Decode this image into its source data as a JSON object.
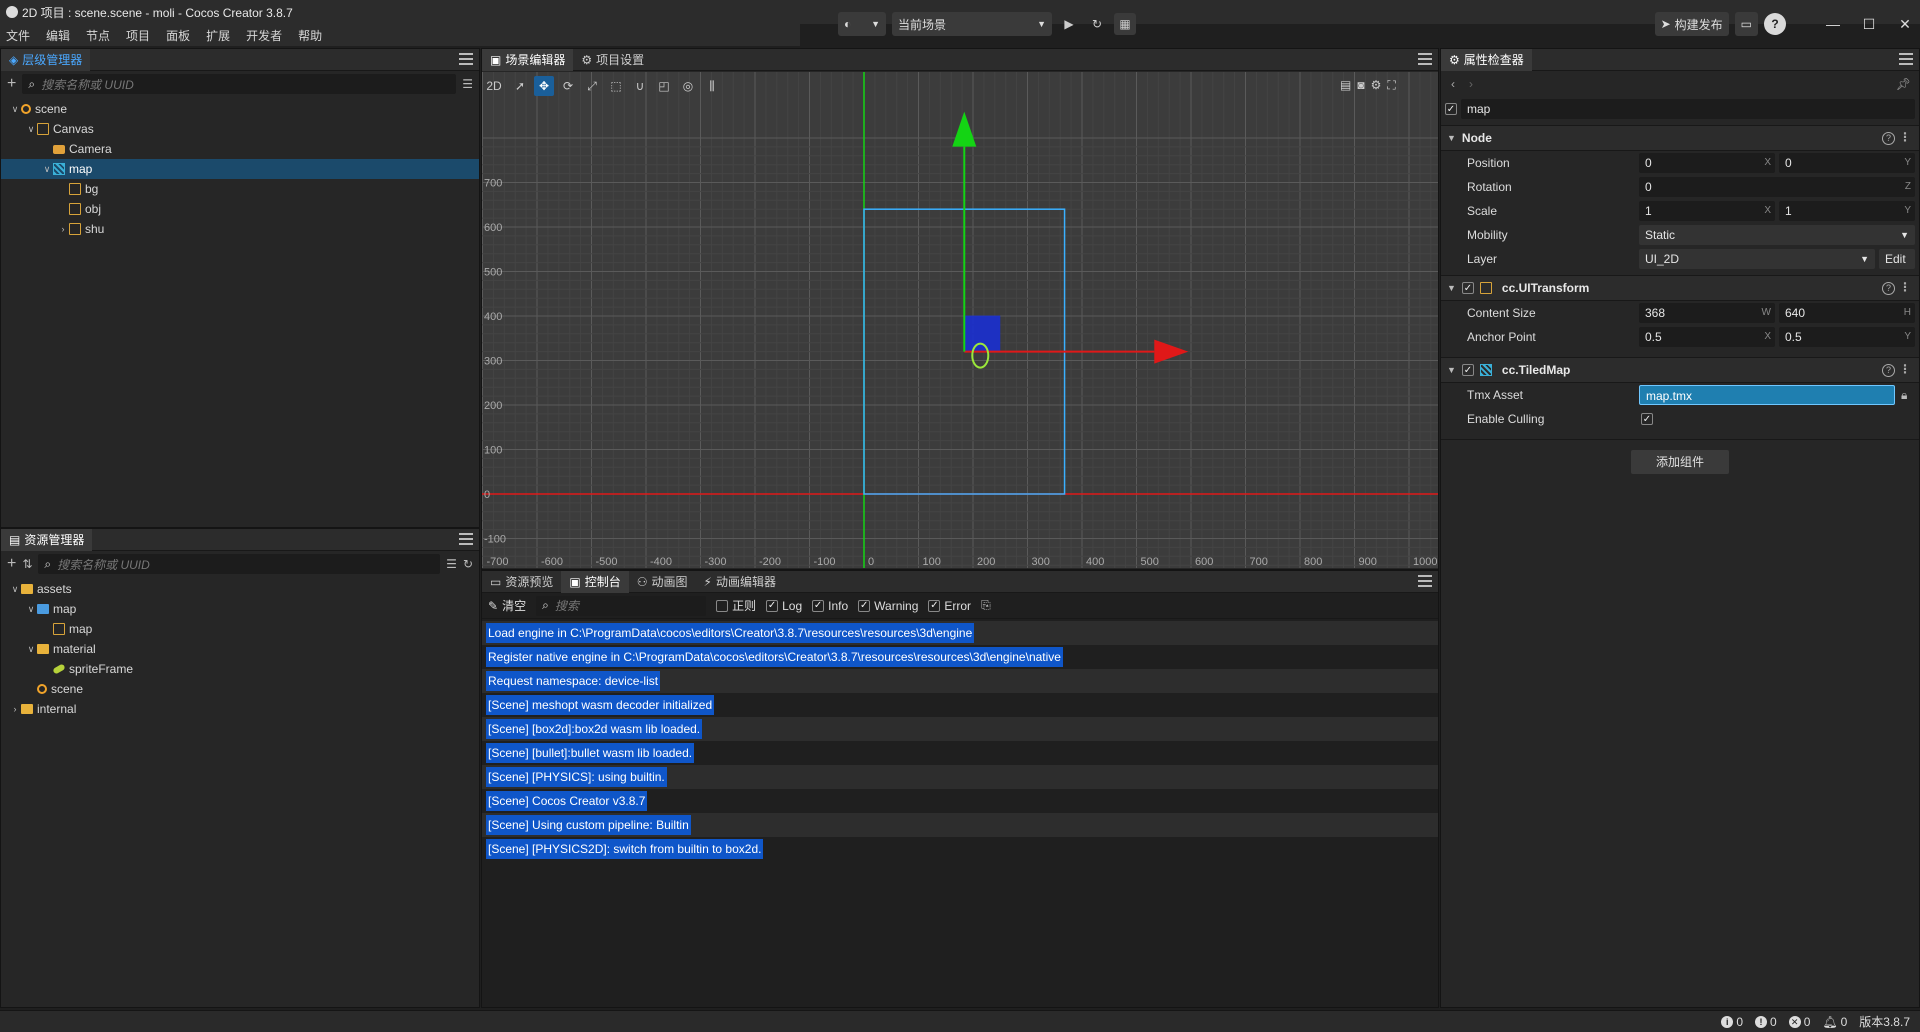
{
  "window": {
    "title": "2D 项目 : scene.scene - moli - Cocos Creator 3.8.7"
  },
  "menu": [
    "文件",
    "编辑",
    "节点",
    "项目",
    "面板",
    "扩展",
    "开发者",
    "帮助"
  ],
  "topbar": {
    "scene_select": "当前场景",
    "build_label": "构建发布"
  },
  "hierarchy": {
    "tab": "层级管理器",
    "search_placeholder": "搜索名称或 UUID",
    "nodes": [
      {
        "label": "scene",
        "indent": 0,
        "arrow": "down",
        "icon": "scene"
      },
      {
        "label": "Canvas",
        "indent": 1,
        "arrow": "down",
        "icon": "node"
      },
      {
        "label": "Camera",
        "indent": 2,
        "arrow": "",
        "icon": "cam"
      },
      {
        "label": "map",
        "indent": 2,
        "arrow": "down",
        "icon": "map",
        "selected": true
      },
      {
        "label": "bg",
        "indent": 3,
        "arrow": "",
        "icon": "node"
      },
      {
        "label": "obj",
        "indent": 3,
        "arrow": "",
        "icon": "node"
      },
      {
        "label": "shu",
        "indent": 3,
        "arrow": "right",
        "icon": "node"
      }
    ]
  },
  "assets": {
    "tab": "资源管理器",
    "search_placeholder": "搜索名称或 UUID",
    "items": [
      {
        "label": "assets",
        "indent": 0,
        "arrow": "down",
        "icon": "db"
      },
      {
        "label": "map",
        "indent": 1,
        "arrow": "down",
        "icon": "folder-blue"
      },
      {
        "label": "map",
        "indent": 2,
        "arrow": "",
        "icon": "map-asset"
      },
      {
        "label": "material",
        "indent": 1,
        "arrow": "down",
        "icon": "folder"
      },
      {
        "label": "spriteFrame",
        "indent": 2,
        "arrow": "",
        "icon": "sf"
      },
      {
        "label": "scene",
        "indent": 1,
        "arrow": "",
        "icon": "scene"
      },
      {
        "label": "internal",
        "indent": 0,
        "arrow": "right",
        "icon": "db"
      }
    ]
  },
  "scene_editor": {
    "tabs": [
      "场景编辑器",
      "项目设置"
    ],
    "mode_2d": "2D",
    "y_ticks": [
      "700",
      "600",
      "500",
      "400",
      "300",
      "200",
      "100",
      "0",
      "-100"
    ],
    "x_ticks": [
      "-700",
      "-600",
      "-500",
      "-400",
      "-300",
      "-200",
      "-100",
      "0",
      "100",
      "200",
      "300",
      "400",
      "500",
      "600",
      "700",
      "800",
      "900",
      "1000"
    ]
  },
  "bottom_panel": {
    "tabs": [
      "资源预览",
      "控制台",
      "动画图",
      "动画编辑器"
    ],
    "clear_label": "清空",
    "search_placeholder": "搜索",
    "filters": [
      {
        "label": "正则",
        "checked": false
      },
      {
        "label": "Log",
        "checked": true
      },
      {
        "label": "Info",
        "checked": true
      },
      {
        "label": "Warning",
        "checked": true
      },
      {
        "label": "Error",
        "checked": true
      }
    ],
    "logs": [
      "Load engine in C:\\ProgramData\\cocos\\editors\\Creator\\3.8.7\\resources\\resources\\3d\\engine",
      "Register native engine in C:\\ProgramData\\cocos\\editors\\Creator\\3.8.7\\resources\\resources\\3d\\engine\\native",
      "Request namespace: device-list",
      "[Scene] meshopt wasm decoder initialized",
      "[Scene] [box2d]:box2d wasm lib loaded.",
      "[Scene] [bullet]:bullet wasm lib loaded.",
      "[Scene] [PHYSICS]: using builtin.",
      "[Scene] Cocos Creator v3.8.7",
      "[Scene] Using custom pipeline: Builtin",
      "[Scene] [PHYSICS2D]: switch from builtin to box2d."
    ]
  },
  "inspector": {
    "tab": "属性检查器",
    "node_name": "map",
    "node_section": "Node",
    "position": {
      "label": "Position",
      "x": "0",
      "y": "0"
    },
    "rotation": {
      "label": "Rotation",
      "z": "0"
    },
    "scale": {
      "label": "Scale",
      "x": "1",
      "y": "1"
    },
    "mobility": {
      "label": "Mobility",
      "value": "Static"
    },
    "layer": {
      "label": "Layer",
      "value": "UI_2D",
      "edit": "Edit"
    },
    "uitransform": {
      "title": "cc.UITransform",
      "content_size_label": "Content Size",
      "w": "368",
      "h": "640",
      "anchor_label": "Anchor Point",
      "ax": "0.5",
      "ay": "0.5"
    },
    "tiledmap": {
      "title": "cc.TiledMap",
      "tmx_label": "Tmx Asset",
      "tmx_value": "map.tmx",
      "culling_label": "Enable Culling"
    },
    "add_component": "添加组件",
    "axis_letters": {
      "x": "X",
      "y": "Y",
      "z": "Z",
      "w": "W",
      "h": "H"
    }
  },
  "statusbar": {
    "info": "0",
    "warn": "0",
    "error": "0",
    "notify": "0",
    "version": "版本3.8.7"
  },
  "colors": {
    "accent": "#0f56c9",
    "selection": "#1b4a6b",
    "grid_bg": "#3c3c3c",
    "x_axis": "#e01818",
    "y_axis": "#14d414",
    "frame": "#3ab0ff"
  }
}
